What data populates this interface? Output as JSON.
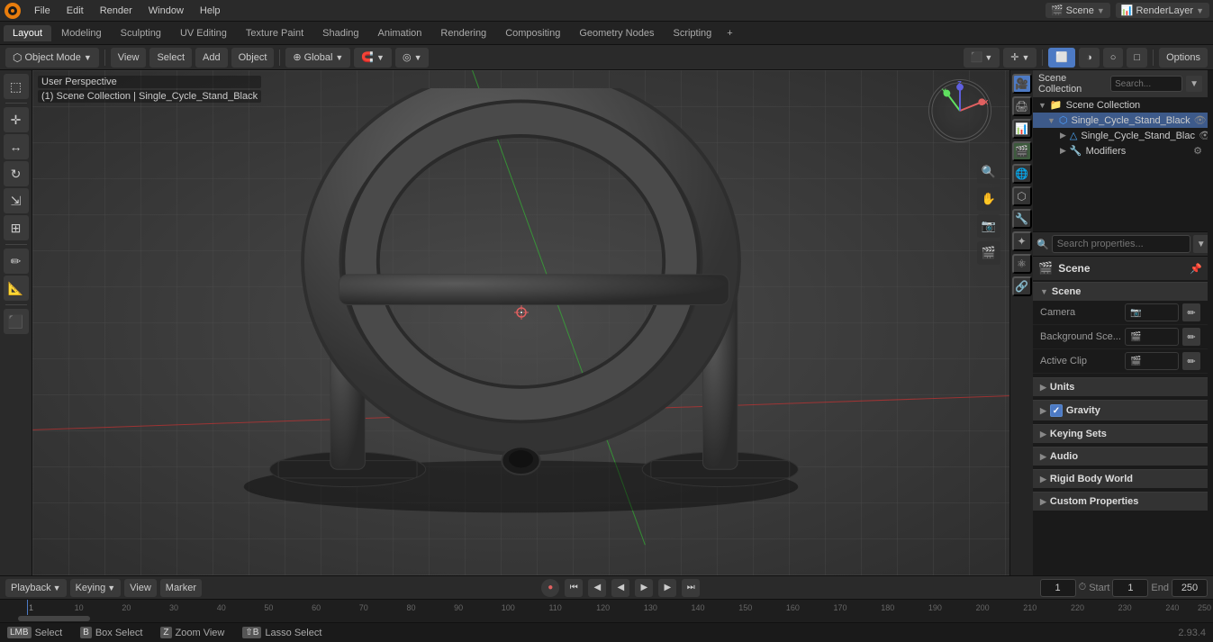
{
  "app": {
    "title": "Blender",
    "file": "File",
    "edit": "Edit",
    "render": "Render",
    "window": "Window",
    "help": "Help"
  },
  "workspace_tabs": {
    "tabs": [
      "Layout",
      "Modeling",
      "Sculpting",
      "UV Editing",
      "Texture Paint",
      "Shading",
      "Animation",
      "Rendering",
      "Compositing",
      "Geometry Nodes",
      "Scripting"
    ],
    "active": "Layout",
    "add_label": "+"
  },
  "header": {
    "object_mode": "Object Mode",
    "view": "View",
    "select": "Select",
    "add": "Add",
    "object": "Object",
    "global": "Global",
    "options": "Options"
  },
  "viewport": {
    "perspective_label": "User Perspective",
    "collection_label": "(1) Scene Collection | Single_Cycle_Stand_Black"
  },
  "outliner": {
    "title": "Scene Collection",
    "items": [
      {
        "label": "Scene Collection",
        "level": 0,
        "type": "collection",
        "expanded": true
      },
      {
        "label": "Single_Cycle_Stand_Black",
        "level": 1,
        "type": "object",
        "expanded": true,
        "selected": true
      },
      {
        "label": "Single_Cycle_Stand_Blac",
        "level": 2,
        "type": "mesh",
        "expanded": false
      },
      {
        "label": "Modifiers",
        "level": 2,
        "type": "modifier",
        "expanded": false
      }
    ]
  },
  "properties": {
    "search_placeholder": "Search properties...",
    "scene_label": "Scene",
    "sections": {
      "scene": {
        "label": "Scene",
        "expanded": true,
        "camera_label": "Camera",
        "camera_value": "",
        "bg_scene_label": "Background Sce...",
        "bg_scene_value": "",
        "active_clip_label": "Active Clip",
        "active_clip_value": ""
      },
      "units": {
        "label": "Units",
        "expanded": false
      },
      "gravity": {
        "label": "Gravity",
        "expanded": false,
        "checked": true
      },
      "keying_sets": {
        "label": "Keying Sets",
        "expanded": false
      },
      "audio": {
        "label": "Audio",
        "expanded": false
      },
      "rigid_body_world": {
        "label": "Rigid Body World",
        "expanded": false
      },
      "custom_properties": {
        "label": "Custom Properties",
        "expanded": false
      }
    }
  },
  "timeline": {
    "playback_label": "Playback",
    "keying_label": "Keying",
    "view_label": "View",
    "marker_label": "Marker",
    "frame_current": "1",
    "start_label": "Start",
    "start_value": "1",
    "end_label": "End",
    "end_value": "250",
    "frames": [
      "1",
      "10",
      "20",
      "30",
      "40",
      "50",
      "60",
      "70",
      "80",
      "90",
      "100",
      "110",
      "120",
      "130",
      "140",
      "150",
      "160",
      "170",
      "180",
      "190",
      "200",
      "210",
      "220",
      "230",
      "240",
      "250"
    ]
  },
  "status_bar": {
    "select_label": "Select",
    "box_select_label": "Box Select",
    "zoom_view_label": "Zoom View",
    "lasso_select_label": "Lasso Select",
    "version": "2.93.4"
  },
  "icons": {
    "expand": "▶",
    "collapse": "▼",
    "check": "✓",
    "object": "⬡",
    "mesh": "△",
    "scene": "🎬",
    "camera": "📷",
    "render": "🎥",
    "material": "●",
    "modifier": "🔧",
    "constraint": "🔗",
    "data": "📊",
    "particles": "✦",
    "physics": "⚛",
    "object_props": "⬜",
    "eye": "👁",
    "lock": "🔒",
    "search": "🔍",
    "add": "+",
    "dropdown": "▼",
    "left": "◀",
    "right": "▶",
    "play": "▶",
    "prev_key": "◀◀",
    "next_key": "▶▶",
    "jump_start": "⏮",
    "jump_end": "⏭"
  }
}
